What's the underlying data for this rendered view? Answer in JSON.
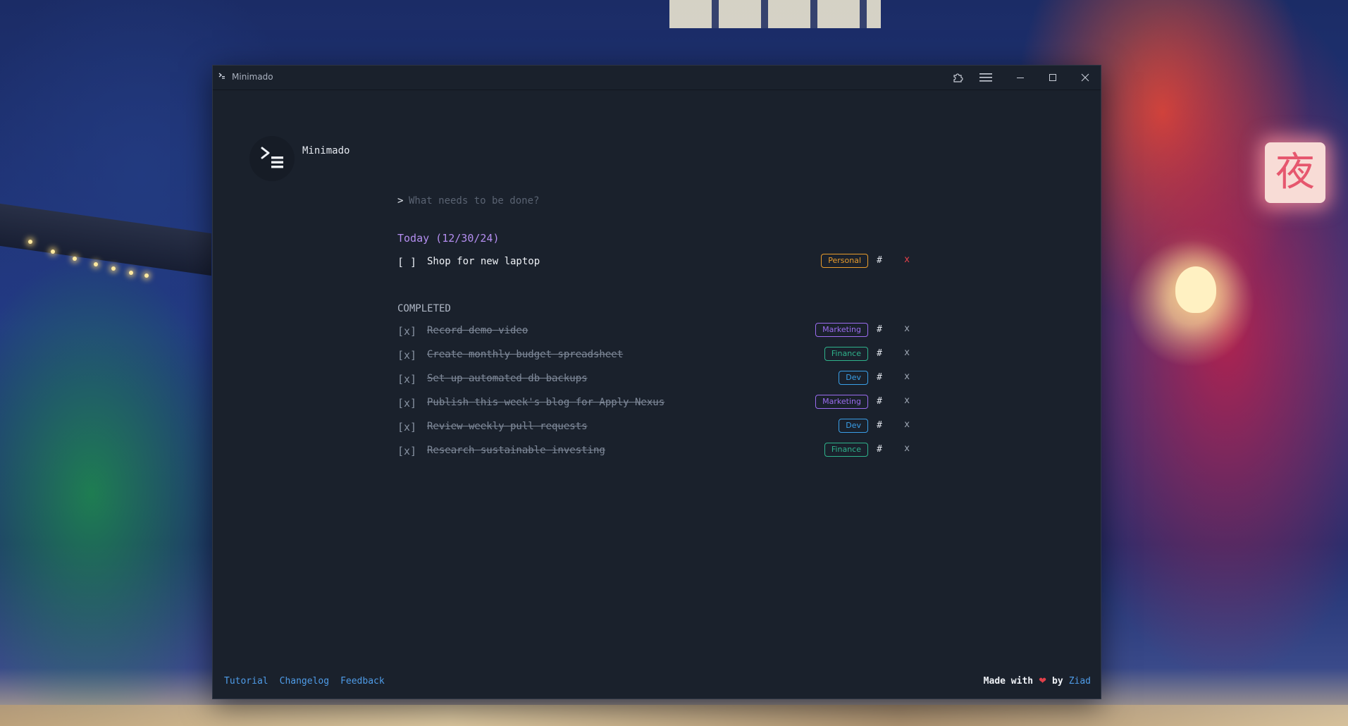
{
  "window": {
    "title": "Minimado"
  },
  "header": {
    "brand": "Minimado"
  },
  "input": {
    "prompt_symbol": ">",
    "placeholder": "What needs to be done?"
  },
  "today": {
    "heading": "Today (12/30/24)",
    "tasks": [
      {
        "checkbox": "[ ]",
        "text": "Shop for new laptop",
        "tag": "Personal",
        "tag_color": "#e89c2c",
        "hash": "#",
        "delete": "x"
      }
    ]
  },
  "completed": {
    "heading": "COMPLETED",
    "tasks": [
      {
        "checkbox": "[x]",
        "text": "Record demo video",
        "tag": "Marketing",
        "tag_color": "#9b6cf0",
        "hash": "#",
        "delete": "x"
      },
      {
        "checkbox": "[x]",
        "text": "Create monthly budget spreadsheet",
        "tag": "Finance",
        "tag_color": "#2fb38c",
        "hash": "#",
        "delete": "x"
      },
      {
        "checkbox": "[x]",
        "text": "Set up automated db backups",
        "tag": "Dev",
        "tag_color": "#3a9fe8",
        "hash": "#",
        "delete": "x"
      },
      {
        "checkbox": "[x]",
        "text": "Publish this week's blog for Apply Nexus",
        "tag": "Marketing",
        "tag_color": "#9b6cf0",
        "hash": "#",
        "delete": "x"
      },
      {
        "checkbox": "[x]",
        "text": "Review weekly pull requests",
        "tag": "Dev",
        "tag_color": "#3a9fe8",
        "hash": "#",
        "delete": "x"
      },
      {
        "checkbox": "[x]",
        "text": "Research sustainable investing",
        "tag": "Finance",
        "tag_color": "#2fb38c",
        "hash": "#",
        "delete": "x"
      }
    ]
  },
  "footer": {
    "links": [
      "Tutorial",
      "Changelog",
      "Feedback"
    ],
    "credit_prefix": "Made with",
    "credit_heart": "❤",
    "credit_by": "by",
    "credit_author": "Ziad"
  },
  "desktop": {
    "sign_glyph": "夜"
  }
}
